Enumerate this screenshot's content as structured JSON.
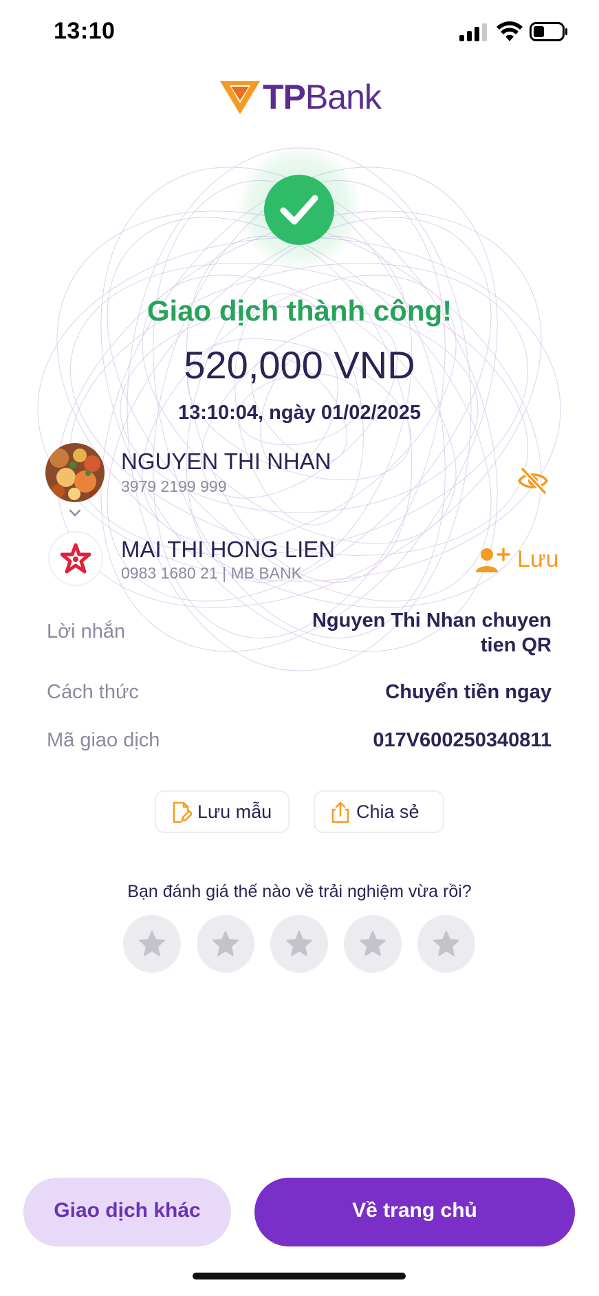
{
  "status_bar": {
    "time": "13:10",
    "icons": [
      "signal-icon",
      "wifi-icon",
      "battery-icon"
    ]
  },
  "brand": {
    "logo_text_bold": "TP",
    "logo_text_light": "Bank",
    "color": "#5b2d90",
    "accent": "#f39b22"
  },
  "result": {
    "title": "Giao dịch thành công!",
    "amount": "520,000 VND",
    "datetime": "13:10:04, ngày 01/02/2025",
    "success_color": "#2fbb68"
  },
  "sender": {
    "name": "NGUYEN THI NHAN",
    "account": "3979 2199 999"
  },
  "recipient": {
    "name": "MAI THI HONG LIEN",
    "account": "0983 1680 21 | MB BANK",
    "save_label": "Lưu"
  },
  "details": {
    "message_label": "Lời nhắn",
    "message_line1": "Nguyen Thi Nhan chuyen",
    "message_line2": "tien QR",
    "method_label": "Cách thức",
    "method_value": "Chuyển tiền ngay",
    "txn_label": "Mã giao dịch",
    "txn_value": "017V600250340811"
  },
  "actions": {
    "save_template": "Lưu mẫu",
    "share": "Chia sẻ"
  },
  "rating": {
    "question": "Bạn đánh giá thế nào về trải nghiệm vừa rồi?",
    "stars": 5,
    "selected": 0
  },
  "footer": {
    "other_txn": "Giao dịch khác",
    "home": "Về trang chủ"
  }
}
